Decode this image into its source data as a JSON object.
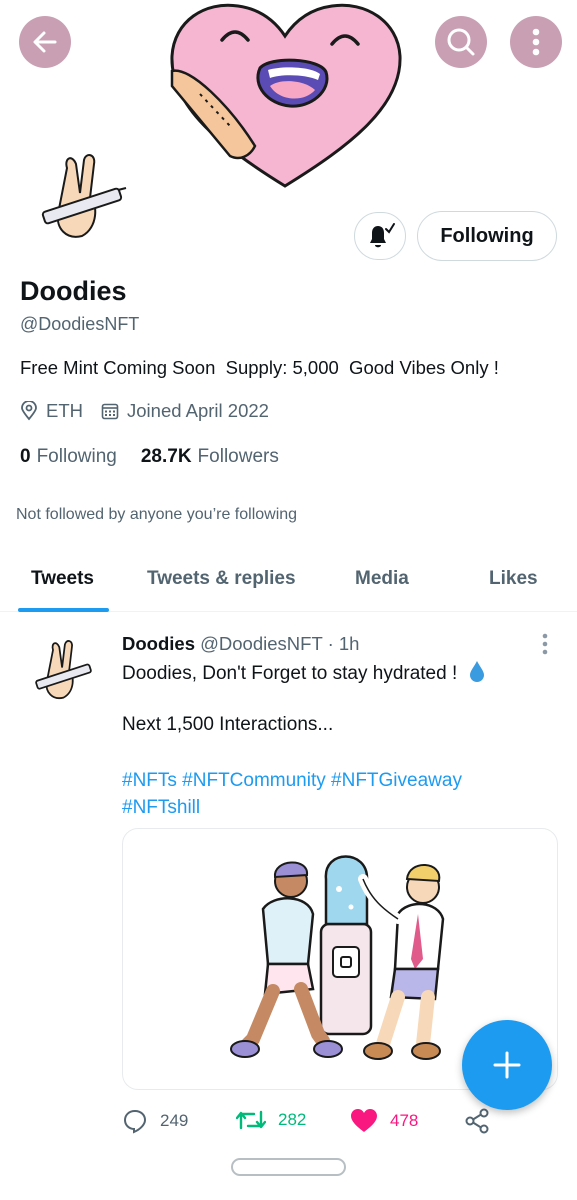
{
  "header": {
    "back_icon": "arrow-left-icon",
    "search_icon": "search-icon",
    "more_icon": "more-vertical-icon",
    "button_color": "#c9a0b3"
  },
  "profile": {
    "name": "Doodies",
    "handle": "@DoodiesNFT",
    "bio": "Free Mint Coming Soon  Supply: 5,000  Good Vibes Only !",
    "location": "ETH",
    "joined": "Joined April 2022",
    "following_count": "0",
    "following_label": "Following",
    "followers_count": "28.7K",
    "followers_label": "Followers",
    "not_followed_text": "Not followed by anyone you’re following",
    "follow_button_label": "Following",
    "notify_icon": "bell-subscribed-icon"
  },
  "tabs": [
    {
      "label": "Tweets",
      "active": true
    },
    {
      "label": "Tweets & replies",
      "active": false
    },
    {
      "label": "Media",
      "active": false
    },
    {
      "label": "Likes",
      "active": false
    }
  ],
  "tweet": {
    "author": "Doodies",
    "handle": "@DoodiesNFT",
    "time": "· 1h",
    "line1": "Doodies, Don't Forget to stay hydrated !",
    "line2": "Next 1,500 Interactions...",
    "hashtags_line1": "#NFTs #NFTCommunity #NFTGiveaway",
    "hashtags_line2": "#NFTshill",
    "replies": "249",
    "retweets": "282",
    "likes": "478",
    "reply_icon": "comment-icon",
    "retweet_icon": "retweet-icon",
    "like_icon": "heart-icon",
    "share_icon": "share-icon"
  },
  "colors": {
    "accent": "#1d9bf0",
    "retweet": "#00ba7c",
    "like": "#f91880",
    "muted": "#536471"
  },
  "fab": {
    "icon": "plus-icon"
  }
}
